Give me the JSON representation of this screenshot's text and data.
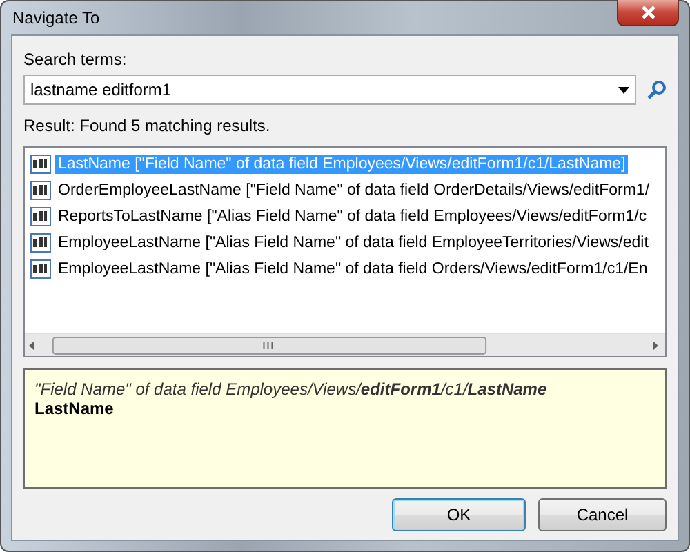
{
  "window": {
    "title": "Navigate To"
  },
  "search": {
    "label": "Search terms:",
    "value": "lastname editform1"
  },
  "result_label": "Result: Found 5 matching results.",
  "results": [
    {
      "text": "LastName [\"Field Name\" of data field Employees/Views/editForm1/c1/LastName]",
      "selected": true
    },
    {
      "text": "OrderEmployeeLastName [\"Field Name\" of data field OrderDetails/Views/editForm1/",
      "selected": false
    },
    {
      "text": "ReportsToLastName [\"Alias Field Name\" of data field Employees/Views/editForm1/c",
      "selected": false
    },
    {
      "text": "EmployeeLastName [\"Alias Field Name\" of data field EmployeeTerritories/Views/edit",
      "selected": false
    },
    {
      "text": "EmployeeLastName [\"Alias Field Name\" of data field Orders/Views/editForm1/c1/En",
      "selected": false
    }
  ],
  "details": {
    "path": "\"Field Name\" of data field Employees/Views/**editForm1**/c1/**LastName**",
    "name": "LastName"
  },
  "buttons": [
    {
      "label": "OK",
      "default": true
    },
    {
      "label": "Cancel",
      "default": false
    }
  ]
}
